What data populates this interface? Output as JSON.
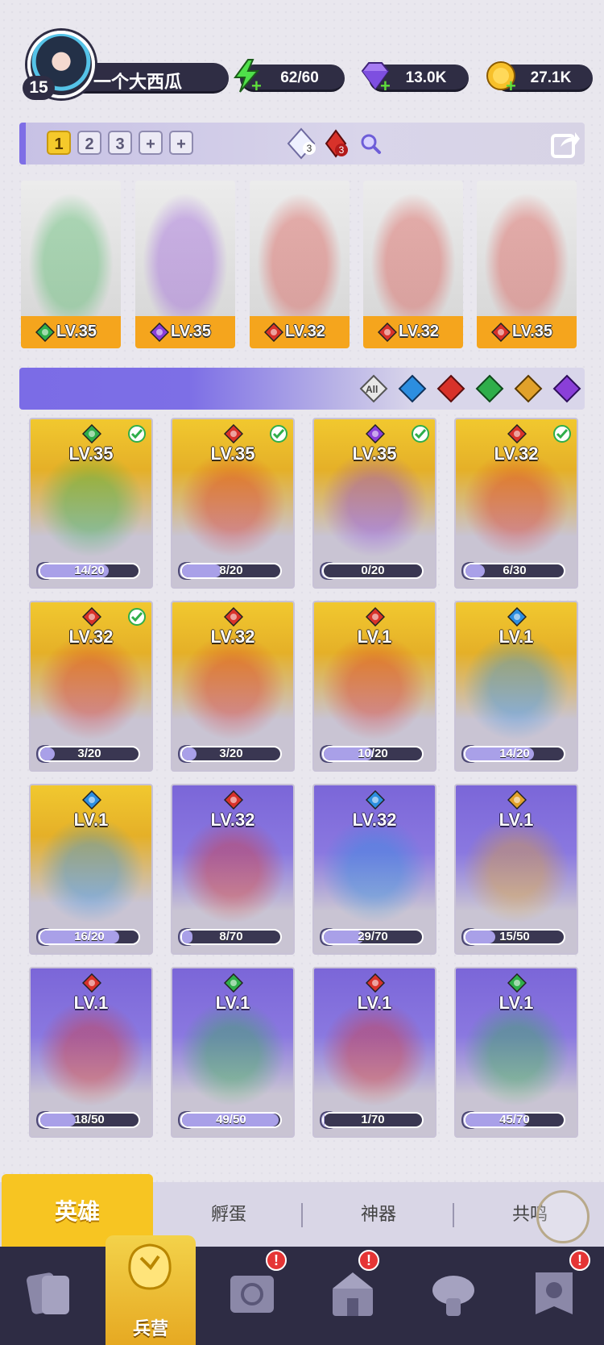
{
  "player": {
    "level": "15",
    "name": "一个大西瓜"
  },
  "resources": {
    "energy": "62/60",
    "gems": "13.0K",
    "coins": "27.1K"
  },
  "team": {
    "slots": [
      "1",
      "2",
      "3",
      "+",
      "+"
    ],
    "crystal_count": "3",
    "flame_count": "3",
    "heroes": [
      {
        "level": "LV.35",
        "element": "nature"
      },
      {
        "level": "LV.35",
        "element": "dark"
      },
      {
        "level": "LV.32",
        "element": "fire"
      },
      {
        "level": "LV.32",
        "element": "fire"
      },
      {
        "level": "LV.35",
        "element": "fire"
      }
    ]
  },
  "filters": {
    "all_label": "All",
    "elements": [
      "water",
      "fire",
      "nature",
      "light",
      "dark"
    ]
  },
  "heroes": [
    {
      "level": "LV.35",
      "shards": "14/20",
      "element": "nature",
      "rarity": "gold",
      "selected": true,
      "progress": 0.7
    },
    {
      "level": "LV.35",
      "shards": "8/20",
      "element": "fire",
      "rarity": "gold",
      "selected": true,
      "progress": 0.4
    },
    {
      "level": "LV.35",
      "shards": "0/20",
      "element": "dark",
      "rarity": "gold",
      "selected": true,
      "progress": 0.0
    },
    {
      "level": "LV.32",
      "shards": "6/30",
      "element": "fire",
      "rarity": "gold",
      "selected": true,
      "progress": 0.2
    },
    {
      "level": "LV.32",
      "shards": "3/20",
      "element": "fire",
      "rarity": "gold",
      "selected": true,
      "progress": 0.15
    },
    {
      "level": "LV.32",
      "shards": "3/20",
      "element": "fire",
      "rarity": "gold",
      "selected": false,
      "progress": 0.15
    },
    {
      "level": "LV.1",
      "shards": "10/20",
      "element": "fire",
      "rarity": "gold",
      "selected": false,
      "progress": 0.5
    },
    {
      "level": "LV.1",
      "shards": "14/20",
      "element": "water",
      "rarity": "gold",
      "selected": false,
      "progress": 0.7
    },
    {
      "level": "LV.1",
      "shards": "16/20",
      "element": "water",
      "rarity": "gold",
      "selected": false,
      "progress": 0.8
    },
    {
      "level": "LV.32",
      "shards": "8/70",
      "element": "fire",
      "rarity": "purple",
      "selected": false,
      "progress": 0.11
    },
    {
      "level": "LV.32",
      "shards": "29/70",
      "element": "water",
      "rarity": "purple",
      "selected": false,
      "progress": 0.41
    },
    {
      "level": "LV.1",
      "shards": "15/50",
      "element": "light",
      "rarity": "purple",
      "selected": false,
      "progress": 0.3
    },
    {
      "level": "LV.1",
      "shards": "18/50",
      "element": "fire",
      "rarity": "purple",
      "selected": false,
      "progress": 0.36
    },
    {
      "level": "LV.1",
      "shards": "49/50",
      "element": "nature",
      "rarity": "purple",
      "selected": false,
      "progress": 0.98
    },
    {
      "level": "LV.1",
      "shards": "1/70",
      "element": "fire",
      "rarity": "purple",
      "selected": false,
      "progress": 0.01
    },
    {
      "level": "LV.1",
      "shards": "45/70",
      "element": "nature",
      "rarity": "purple",
      "selected": false,
      "progress": 0.64
    }
  ],
  "tabs": [
    "英雄",
    "孵蛋",
    "神器",
    "共鸣"
  ],
  "nav": {
    "active_label": "兵营"
  },
  "colors": {
    "gold": "#f1c82f",
    "purple": "#7b66d8",
    "fire": "#d8322a",
    "water": "#2c8ee0",
    "nature": "#2fae4a",
    "dark": "#8a3fd8",
    "light": "#e1a12a"
  }
}
